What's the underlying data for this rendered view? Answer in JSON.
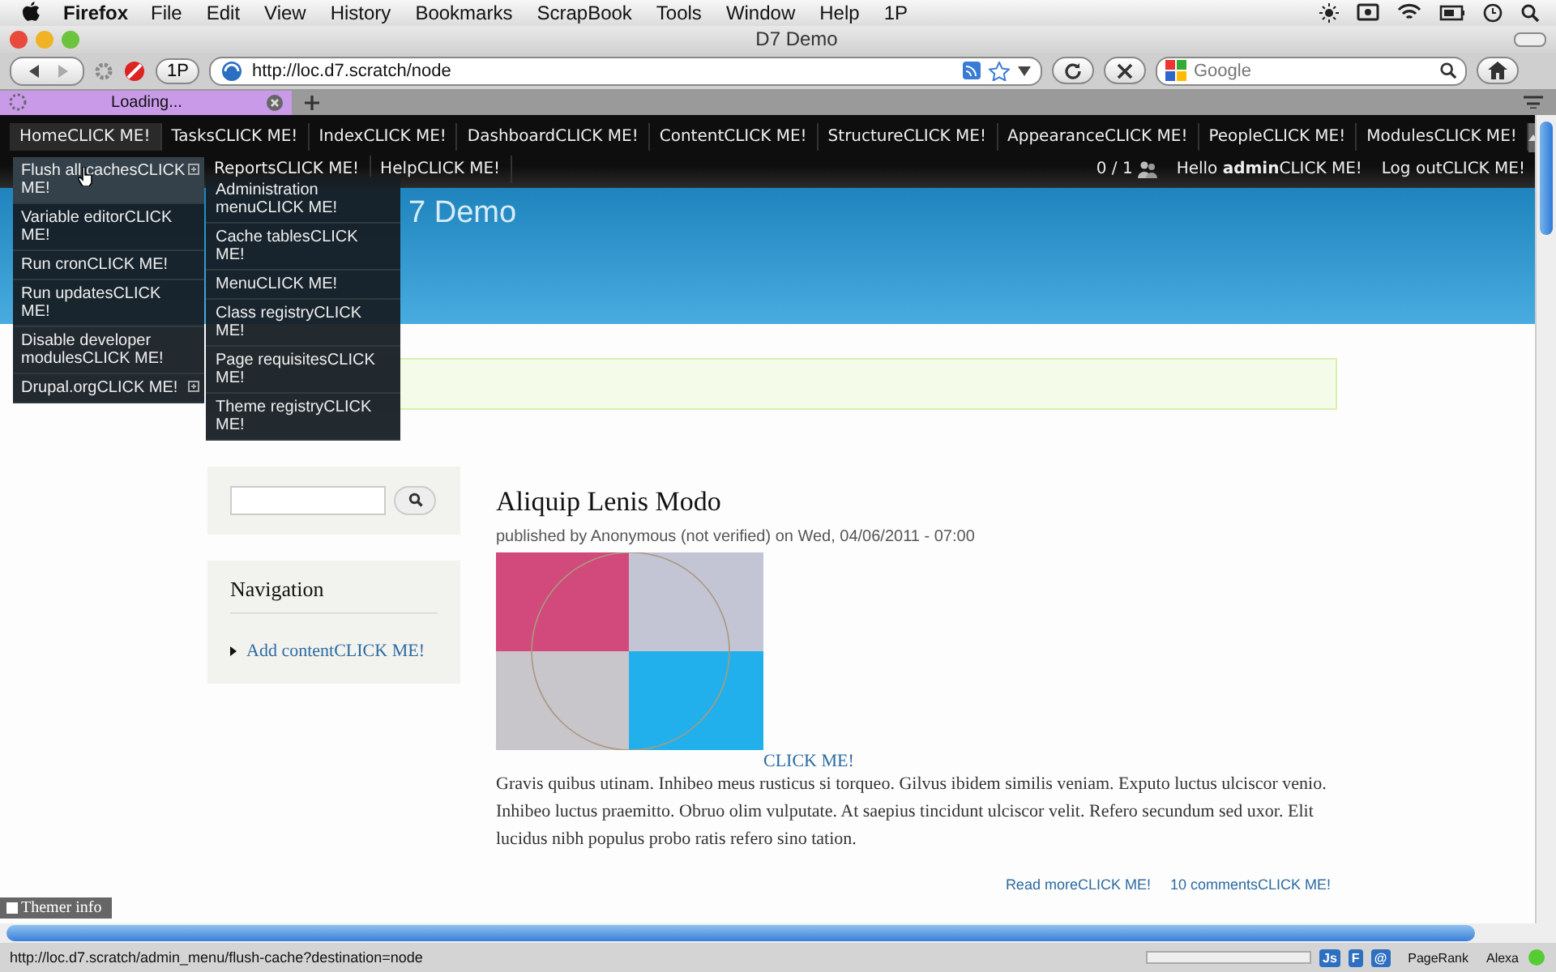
{
  "menubar": {
    "app": "Firefox",
    "items": [
      "File",
      "Edit",
      "View",
      "History",
      "Bookmarks",
      "ScrapBook",
      "Tools",
      "Window",
      "Help",
      "1P"
    ]
  },
  "window": {
    "title": "D7 Demo"
  },
  "toolbar": {
    "profile_button": "1P",
    "url": "http://loc.d7.scratch/node",
    "search_placeholder": "Google"
  },
  "tabs": [
    {
      "label": "Loading...",
      "selected": true
    }
  ],
  "admin_menu": {
    "items": [
      {
        "label": "HomeCLICK ME!",
        "selected": true
      },
      {
        "label": "TasksCLICK ME!",
        "selected": false
      },
      {
        "label": "IndexCLICK ME!",
        "selected": false
      },
      {
        "label": "DashboardCLICK ME!",
        "selected": false
      },
      {
        "label": "ContentCLICK ME!",
        "selected": false
      },
      {
        "label": "StructureCLICK ME!",
        "selected": false
      },
      {
        "label": "AppearanceCLICK ME!",
        "selected": false
      },
      {
        "label": "PeopleCLICK ME!",
        "selected": false
      },
      {
        "label": "ModulesCLICK ME!",
        "selected": false
      }
    ],
    "second_row": [
      "ReportsCLICK ME!",
      "HelpCLICK ME!"
    ],
    "user_count": "0 / 1",
    "greeting": "Hello **admin**CLICK ME!",
    "logout": "Log outCLICK ME!"
  },
  "dropdown": {
    "items": [
      {
        "label": "Flush all cachesCLICK ME!",
        "has_submenu": true,
        "selected": true
      },
      {
        "label": "Variable editorCLICK ME!",
        "has_submenu": false,
        "selected": false
      },
      {
        "label": "Run cronCLICK ME!",
        "has_submenu": false,
        "selected": false
      },
      {
        "label": "Run updatesCLICK ME!",
        "has_submenu": false,
        "selected": false
      },
      {
        "label": "Disable developer modulesCLICK ME!",
        "has_submenu": false,
        "selected": false
      },
      {
        "label": "Drupal.orgCLICK ME!",
        "has_submenu": true,
        "selected": false
      }
    ]
  },
  "submenu": {
    "items": [
      "Administration menuCLICK ME!",
      "Cache tablesCLICK ME!",
      "MenuCLICK ME!",
      "Class registryCLICK ME!",
      "Page requisitesCLICK ME!",
      "Theme registryCLICK ME!"
    ]
  },
  "site_name": "7 Demo",
  "sidebar": {
    "navigation": {
      "title": "Navigation",
      "links": [
        "Add contentCLICK ME!"
      ]
    }
  },
  "article": {
    "title": "Aliquip Lenis Modo",
    "meta": "published by Anonymous (not verified) on Wed, 04/06/2011 - 07:00",
    "image_link": "CLICK ME!",
    "body": "Gravis quibus utinam. Inhibeo meus rusticus si torqueo. Gilvus ibidem similis veniam. Exputo luctus ulciscor venio. Inhibeo luctus praemitto. Obruo olim vulputate. At saepius tincidunt ulciscor velit. Refero secundum sed uxor. Elit lucidus nibh populus probo ratis refero sino tation.",
    "links": [
      "Read moreCLICK ME!",
      "10 commentsCLICK ME!"
    ]
  },
  "themer_info": {
    "label": "Themer info",
    "checked": false
  },
  "status_bar": {
    "progress": {
      "level": 0
    },
    "url": "http://loc.d7.scratch/admin_menu/flush-cache?destination=node",
    "badges": [
      "Js",
      "F",
      "@"
    ],
    "labels": [
      "PageRank",
      "Alexa"
    ]
  }
}
